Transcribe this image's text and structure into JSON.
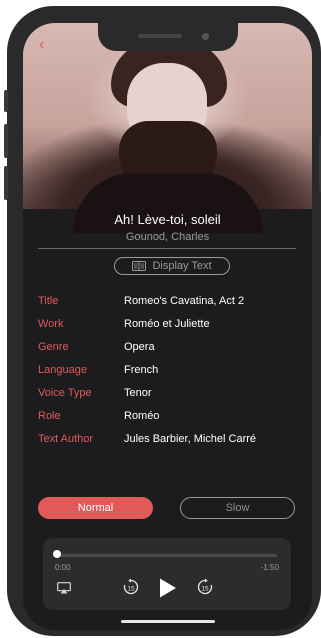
{
  "song": {
    "title": "Ah! Lève-toi, soleil",
    "composer": "Gounod, Charles"
  },
  "display_text_button": {
    "label": "Display Text",
    "icon": "book-icon"
  },
  "metadata": [
    {
      "label": "Title",
      "value": "Romeo's Cavatina, Act 2"
    },
    {
      "label": "Work",
      "value": "Roméo et Juliette"
    },
    {
      "label": "Genre",
      "value": "Opera"
    },
    {
      "label": "Language",
      "value": "French"
    },
    {
      "label": "Voice Type",
      "value": "Tenor"
    },
    {
      "label": "Role",
      "value": "Roméo"
    },
    {
      "label": "Text Author",
      "value": "Jules Barbier, Michel Carré"
    }
  ],
  "speed": {
    "normal_label": "Normal",
    "slow_label": "Slow",
    "selected": "Normal"
  },
  "player": {
    "current_time": "0:00",
    "remaining_time": "-1:50",
    "progress": 0.0,
    "skip_back_seconds": "15",
    "skip_forward_seconds": "15"
  },
  "colors": {
    "accent": "#e05a5a",
    "background": "#1c1c1e",
    "player_bg": "#2c2c2e"
  }
}
